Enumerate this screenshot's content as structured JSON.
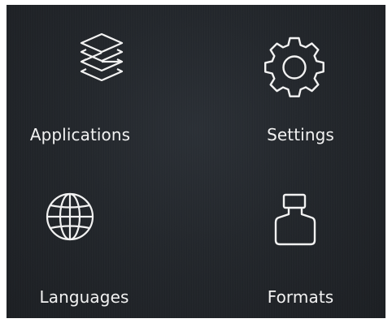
{
  "menu": {
    "items": [
      {
        "label": "Applications",
        "icon": "layers-icon"
      },
      {
        "label": "Settings",
        "icon": "gear-icon"
      },
      {
        "label": "Languages",
        "icon": "globe-icon"
      },
      {
        "label": "Formats",
        "icon": "weight-icon"
      }
    ]
  },
  "colors": {
    "background": "#23272c",
    "foreground": "#f2f2f2"
  }
}
